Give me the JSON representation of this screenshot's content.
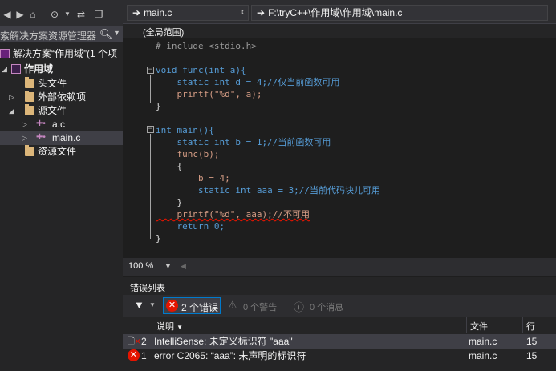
{
  "solution_explorer": {
    "search_placeholder": "索解决方案资源管理器(",
    "tree": [
      {
        "label": "解决方案“作用域”(1 个项",
        "selected": false
      },
      {
        "label": "作用域",
        "selected": false
      },
      {
        "label": "头文件",
        "selected": false
      },
      {
        "label": "外部依赖项",
        "selected": false
      },
      {
        "label": "源文件",
        "selected": false
      },
      {
        "label": "a.c",
        "selected": false
      },
      {
        "label": "main.c",
        "selected": true
      },
      {
        "label": "资源文件",
        "selected": false
      }
    ]
  },
  "editor": {
    "file_dropdown": "main.c",
    "path_dropdown": "F:\\tryC++\\作用域\\作用域\\main.c",
    "scope": "(全局范围)",
    "zoom": "100 %"
  },
  "code_lines": [
    "# include <stdio.h>",
    "",
    "void func(int a){",
    "    static int d = 4;//仅当前函数可用",
    "    printf(\"%d\", a);",
    "}",
    "",
    "int main(){",
    "    static int b = 1;//当前函数可用",
    "    func(b);",
    "    {",
    "        b = 4;",
    "        static int aaa = 3;//当前代码块儿可用",
    "    }",
    "    printf(\"%d\", aaa);//不可用",
    "    return 0;",
    "}"
  ],
  "error_list": {
    "title": "错误列表",
    "errors_button": "2 个错误",
    "warnings_button": "0 个警告",
    "messages_button": "0 个消息",
    "columns": {
      "desc": "说明",
      "file": "文件",
      "line": "行"
    },
    "rows": [
      {
        "num": "2",
        "desc": "IntelliSense:  未定义标识符 \"aaa\"",
        "file": "main.c",
        "line": "15",
        "selected": true
      },
      {
        "num": "1",
        "desc": "error C2065:  “aaa”: 未声明的标识符",
        "file": "main.c",
        "line": "15",
        "selected": false
      }
    ]
  }
}
